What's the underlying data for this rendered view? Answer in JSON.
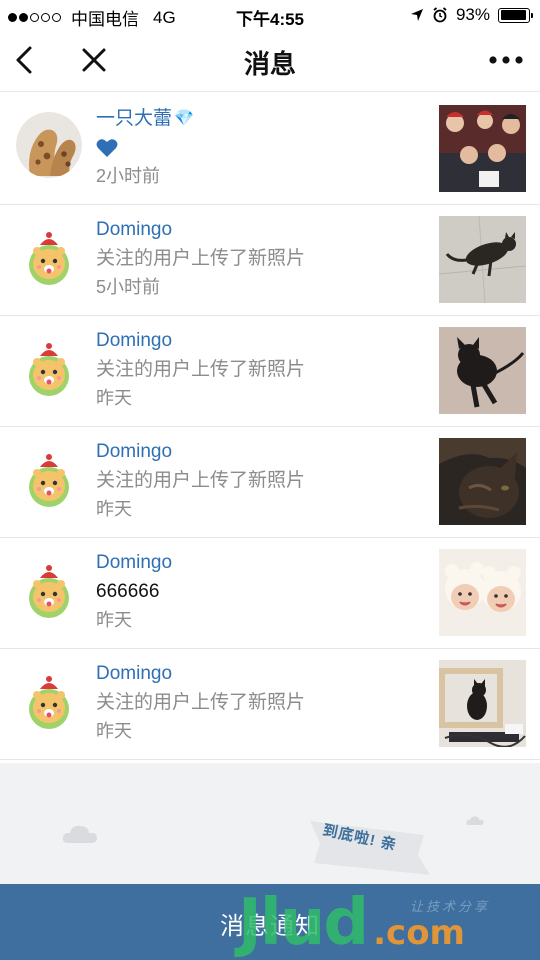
{
  "status_bar": {
    "carrier": "中国电信",
    "network": "4G",
    "time": "下午4:55",
    "battery_text": "93%",
    "battery_level": 0.93,
    "signal_bars_filled": 2,
    "signal_bars_total": 5
  },
  "nav": {
    "title": "消息",
    "back_icon": "chevron-left-icon",
    "close_icon": "close-icon",
    "more_icon": "more-icon"
  },
  "messages": [
    {
      "name": "一只大蕾",
      "name_emoji": "💎",
      "text": "",
      "text_icon": "heart",
      "time": "2小时前",
      "text_dark": false,
      "avatar": "giraffe",
      "thumb": "family-photo"
    },
    {
      "name": "Domingo",
      "text": "关注的用户上传了新照片",
      "time": "5小时前",
      "text_dark": false,
      "avatar": "mascot",
      "thumb": "cat-on-floor"
    },
    {
      "name": "Domingo",
      "text": "关注的用户上传了新照片",
      "time": "昨天",
      "text_dark": false,
      "avatar": "mascot",
      "thumb": "black-kitten"
    },
    {
      "name": "Domingo",
      "text": "关注的用户上传了新照片",
      "time": "昨天",
      "text_dark": false,
      "avatar": "mascot",
      "thumb": "tabby-cat-closeup"
    },
    {
      "name": "Domingo",
      "text": "666666",
      "time": "昨天",
      "text_dark": true,
      "avatar": "mascot",
      "thumb": "babies-photo"
    },
    {
      "name": "Domingo",
      "text": "关注的用户上传了新照片",
      "time": "昨天",
      "text_dark": false,
      "avatar": "mascot",
      "thumb": "cat-on-shelf"
    }
  ],
  "end_banner": {
    "text": "到底啦! 亲"
  },
  "tabbar": {
    "label": "消息通知"
  },
  "watermark": {
    "main": "Jlud",
    "suffix": ".com",
    "sub": "让技术分享"
  },
  "colors": {
    "link": "#2e6fb5",
    "tabbar": "#3e6f9e",
    "gray_text": "#8c8c8c",
    "footer_bg": "#f1f2f4"
  }
}
